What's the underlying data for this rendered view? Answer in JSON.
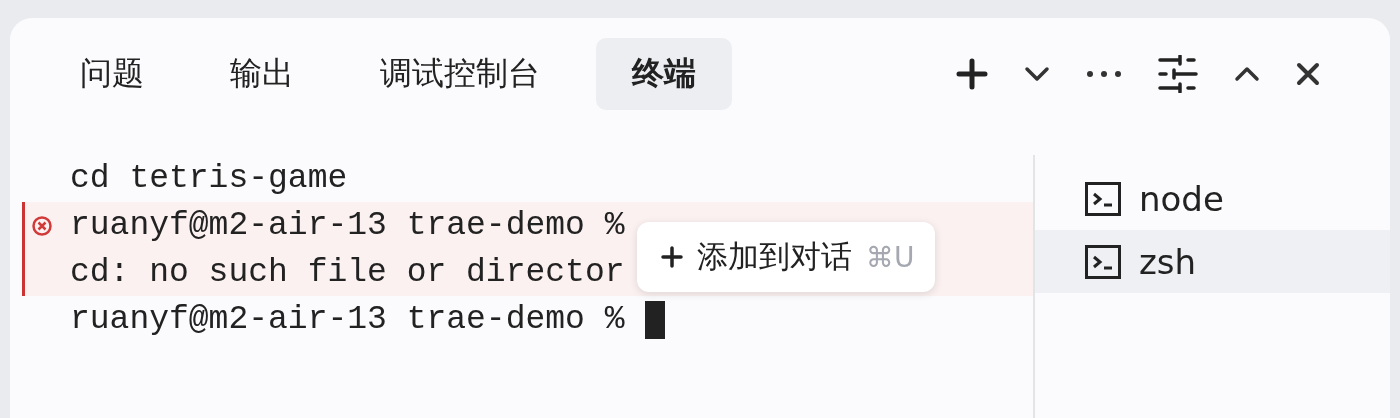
{
  "tabs": [
    {
      "label": "问题",
      "selected": false
    },
    {
      "label": "输出",
      "selected": false
    },
    {
      "label": "调试控制台",
      "selected": false
    },
    {
      "label": "终端",
      "selected": true
    }
  ],
  "terminal": {
    "lines": [
      {
        "kind": "plain",
        "text": "cd tetris-game",
        "cursor": false
      },
      {
        "kind": "error-start",
        "text": "ruanyf@m2-air-13 trae-demo %",
        "cursor": false
      },
      {
        "kind": "error",
        "text": "cd: no such file or director",
        "cursor": false
      },
      {
        "kind": "plain",
        "text": "ruanyf@m2-air-13 trae-demo %",
        "cursor": true
      }
    ],
    "popup": {
      "label": "添加到对话",
      "shortcut": "⌘U"
    }
  },
  "sessions": [
    {
      "name": "node",
      "selected": false
    },
    {
      "name": "zsh",
      "selected": true
    }
  ]
}
